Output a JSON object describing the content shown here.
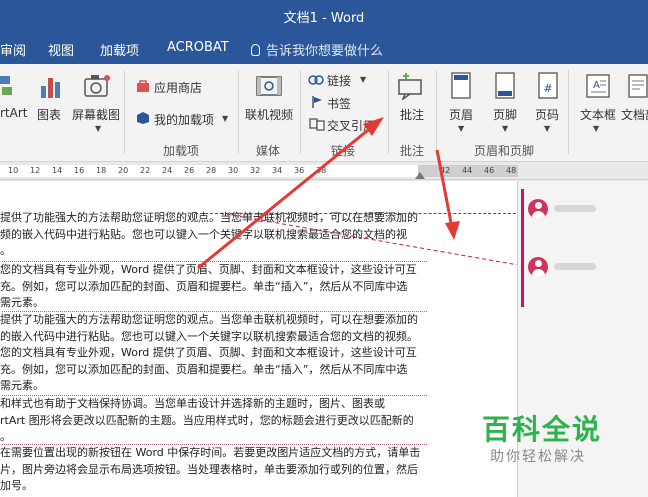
{
  "window": {
    "title": "文档1  -  Word"
  },
  "tabs": [
    {
      "label": "审阅"
    },
    {
      "label": "视图"
    },
    {
      "label": "加载项"
    },
    {
      "label": "ACROBAT"
    },
    {
      "label": "告诉我你想要做什么"
    }
  ],
  "ribbon": {
    "smartart": "rtArt",
    "chart": "图表",
    "screenshot": "屏幕截图",
    "app_store": "应用商店",
    "my_addins": "我的加载项",
    "online_video": "联机视频",
    "link": "链接",
    "bookmark": "书签",
    "crossref": "交叉引用",
    "comment": "批注",
    "header": "页眉",
    "footer": "页脚",
    "page_number": "页码",
    "textbox": "文本框",
    "text_parts": "文档部件",
    "groups": {
      "addins": "加载项",
      "media": "媒体",
      "links": "链接",
      "comments": "批注",
      "header_footer": "页眉和页脚"
    }
  },
  "ruler": [
    "10",
    "12",
    "14",
    "16",
    "18",
    "20",
    "22",
    "24",
    "26",
    "28",
    "30",
    "32",
    "34",
    "36",
    "38",
    "42",
    "44",
    "46",
    "48"
  ],
  "document": {
    "paragraphs": [
      "提供了功能强大的方法帮助您证明您的观点。当您单击联机视频时，可以在想要添加的\n频的嵌入代码中进行粘贴。您也可以键入一个关键字以联机搜索最适合您的文档的视\n。",
      "您的文档具有专业外观，Word 提供了页眉、页脚、封面和文本框设计，这些设计可互\n充。例如，您可以添加匹配的封面、页眉和提要栏。单击“插入”，然后从不同库中选\n需元素。",
      "提供了功能强大的方法帮助您证明您的观点。当您单击联机视频时，可以在想要添加的\n的嵌入代码中进行粘贴。您也可以键入一个关键字以联机搜索最适合您的文档的视频。\n您的文档具有专业外观，Word 提供了页眉、页脚、封面和文本框设计，这些设计可互\n充。例如，您可以添加匹配的封面、页眉和提要栏。单击“插入”，然后从不同库中选\n需元素。",
      "和样式也有助于文档保持协调。当您单击设计并选择新的主题时，图片、图表或\nrtArt 图形将会更改以匹配新的主题。当应用样式时，您的标题会进行更改以匹配新的\n。",
      "在需要位置出现的新按钮在 Word 中保存时间。若要更改图片适应文档的方式，请单击\n片，图片旁边将会显示布局选项按钮。当处理表格时，单击要添加行或列的位置，然后\n加号。"
    ]
  },
  "watermark": {
    "brand": "百科全说",
    "slogan": "助你轻松解决"
  },
  "colors": {
    "accent": "#2b579a",
    "comment": "#c2185b",
    "arrow": "#e53935",
    "watermark": "#2db24c"
  }
}
